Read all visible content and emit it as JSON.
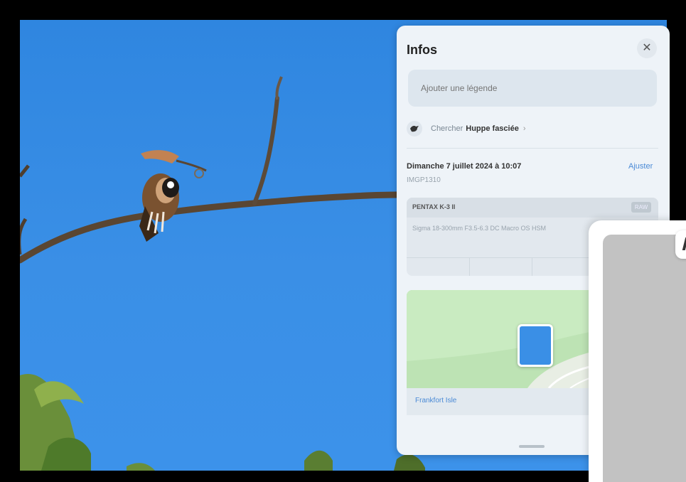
{
  "info_panel": {
    "title": "Infos",
    "close_icon": "close-icon",
    "caption_placeholder": "Ajouter une légende",
    "lookup": {
      "prefix": "Chercher",
      "species": "Huppe fasciée",
      "icon": "bird-icon"
    },
    "date": "Dimanche 7 juillet 2024 à 10:07",
    "filename": "IMGP1310",
    "adjust_label": "Ajuster",
    "exif": {
      "camera": "PENTAX K-3 II",
      "format_badge": "RAW",
      "lens": "Sigma 18-300mm F3.5-6.3 DC Macro OS HSM"
    },
    "map": {
      "location_label": "Frankfort Isle"
    }
  },
  "colors": {
    "sky": "#3a8fe6",
    "panel_bg": "#eef3f8",
    "accent": "#4a8ad6"
  }
}
